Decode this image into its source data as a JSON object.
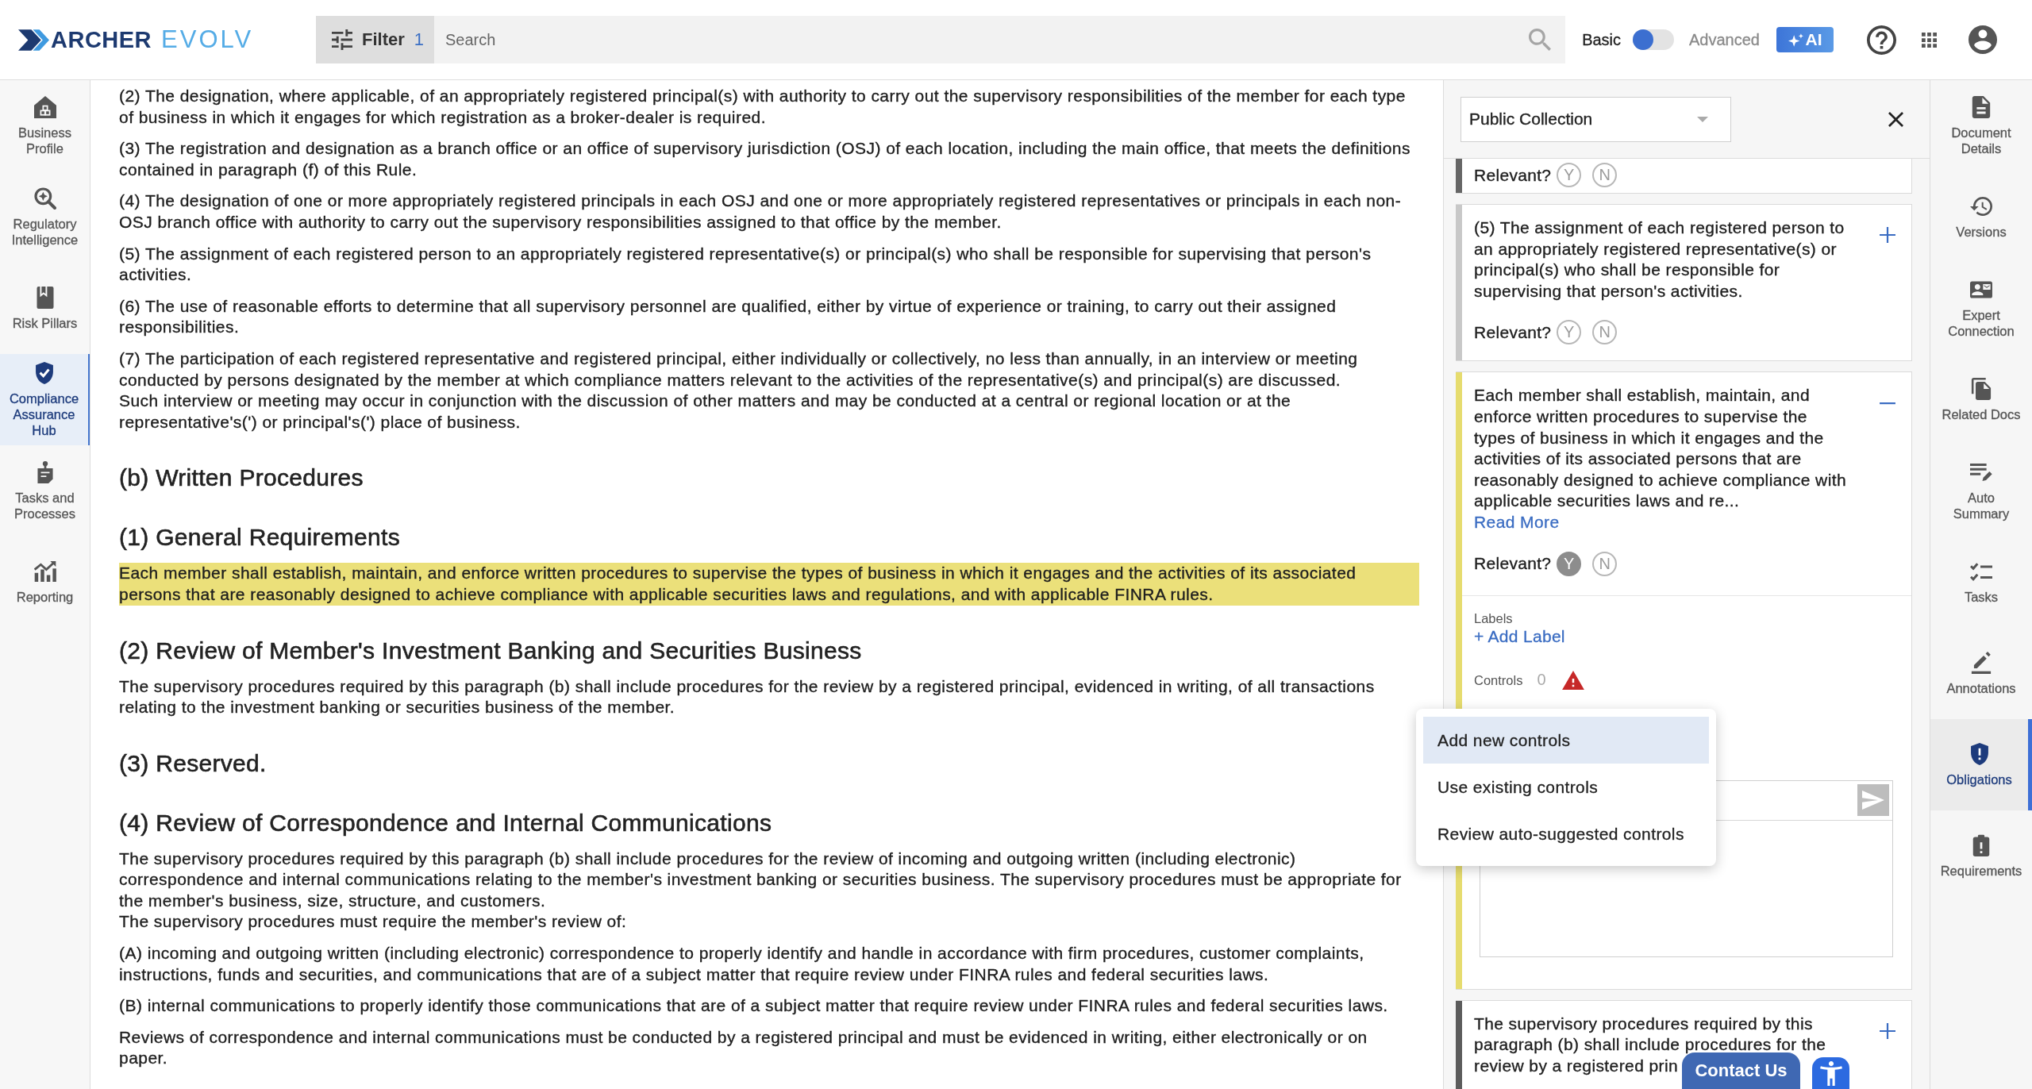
{
  "header": {
    "logo": {
      "brand": "ARCHER",
      "product": "EVOLV"
    },
    "filter": {
      "label": "Filter",
      "count": "1"
    },
    "search": {
      "placeholder": "Search"
    },
    "mode_toggle": {
      "left_label": "Basic",
      "right_label": "Advanced",
      "on": false
    },
    "ai_button": {
      "label": "AI"
    }
  },
  "left_nav": {
    "items": [
      {
        "label": "Business Profile",
        "selected": false
      },
      {
        "label": "Regulatory Intelligence",
        "selected": false
      },
      {
        "label": "Risk Pillars",
        "selected": false
      },
      {
        "label": "Compliance Assurance Hub",
        "selected": true
      },
      {
        "label": "Tasks and Processes",
        "selected": false
      },
      {
        "label": "Reporting",
        "selected": false
      }
    ]
  },
  "document": {
    "blocks": [
      {
        "kind": "paragraph",
        "highlighted": false,
        "lines": [
          "(2) The designation, where applicable, of an appropriately registered principal(s) with authority to carry out the supervisory responsibilities of the member for each type of business in which it engages for which registration as a broker-dealer is required."
        ]
      },
      {
        "kind": "paragraph",
        "highlighted": false,
        "lines": [
          "(3) The registration and designation as a branch office or an office of supervisory jurisdiction (OSJ) of each location, including the main office, that meets the definitions contained in paragraph (f) of this Rule."
        ]
      },
      {
        "kind": "paragraph",
        "highlighted": false,
        "lines": [
          "(4) The designation of one or more appropriately registered principals in each OSJ and one or more appropriately registered representatives or principals in each non-OSJ branch office with authority to carry out the supervisory responsibilities assigned to that office by the member."
        ]
      },
      {
        "kind": "paragraph",
        "highlighted": false,
        "lines": [
          "(5) The assignment of each registered person to an appropriately registered representative(s) or principal(s) who shall be responsible for supervising that person's activities."
        ]
      },
      {
        "kind": "paragraph",
        "highlighted": false,
        "lines": [
          "(6) The use of reasonable efforts to determine that all supervisory personnel are qualified, either by virtue of experience or training, to carry out their assigned responsibilities."
        ]
      },
      {
        "kind": "paragraph",
        "highlighted": false,
        "lines": [
          "(7) The participation of each registered representative and registered principal, either individually or collectively, no less than annually, in an interview or meeting conducted by persons designated by the member at which compliance matters relevant to the activities of the representative(s) and principal(s) are discussed.",
          "Such interview or meeting may occur in conjunction with the discussion of other matters and may be conducted at a central or regional location or at the representative's(') or principal's(') place of business."
        ]
      },
      {
        "kind": "heading",
        "text": "(b) Written Procedures"
      },
      {
        "kind": "heading",
        "text": "(1) General Requirements"
      },
      {
        "kind": "paragraph",
        "highlighted": true,
        "lines": [
          "Each member shall establish, maintain, and enforce written procedures to supervise the types of business in which it engages and the activities of its associated persons that are reasonably designed to achieve compliance with applicable securities laws and regulations, and with applicable FINRA rules."
        ]
      },
      {
        "kind": "heading",
        "text": "(2) Review of Member's Investment Banking and Securities Business"
      },
      {
        "kind": "paragraph",
        "highlighted": false,
        "lines": [
          "The supervisory procedures required by this paragraph (b) shall include procedures for the review by a registered principal, evidenced in writing, of all transactions relating to the investment banking or securities business of the member."
        ]
      },
      {
        "kind": "heading",
        "text": "(3) Reserved."
      },
      {
        "kind": "heading",
        "text": "(4) Review of Correspondence and Internal Communications"
      },
      {
        "kind": "paragraph",
        "highlighted": false,
        "lines": [
          "The supervisory procedures required by this paragraph (b) shall include procedures for the review of incoming and outgoing written (including electronic) correspondence and internal communications relating to the member's investment banking or securities business. The supervisory procedures must be appropriate for the member's business, size, structure, and customers.",
          "The supervisory procedures must require the member's review of:"
        ]
      },
      {
        "kind": "paragraph",
        "highlighted": false,
        "lines": [
          "(A) incoming and outgoing written (including electronic) correspondence to properly identify and handle in accordance with firm procedures, customer complaints, instructions, funds and securities, and communications that are of a subject matter that require review under FINRA rules and federal securities laws."
        ]
      },
      {
        "kind": "paragraph",
        "highlighted": false,
        "lines": [
          "(B) internal communications to properly identify those communications that are of a subject matter that require review under FINRA rules and federal securities laws."
        ]
      },
      {
        "kind": "paragraph",
        "highlighted": false,
        "lines": [
          "Reviews of correspondence and internal communications must be conducted by a registered principal and must be evidenced in writing, either electronically or on paper."
        ]
      }
    ]
  },
  "panel": {
    "collection_select": {
      "value": "Public Collection"
    },
    "cards": [
      {
        "kind": "clipped",
        "color": "#666666",
        "relevant": {
          "label": "Relevant?",
          "options": [
            {
              "label": "Y",
              "selected": false
            },
            {
              "label": "N",
              "selected": false
            }
          ]
        }
      },
      {
        "kind": "full",
        "color": "#c8c8c8",
        "expanded": false,
        "text_parts": [
          "(5) The assignment of each registered person to an appropriately registered representative(s) or principal(s) who shall be responsible for supervising that person's activities."
        ],
        "relevant": {
          "label": "Relevant?",
          "options": [
            {
              "label": "Y",
              "selected": false
            },
            {
              "label": "N",
              "selected": false
            }
          ]
        }
      },
      {
        "kind": "full",
        "color": "#e6dc6e",
        "expanded": true,
        "text_parts": [
          "Each member shall establish, maintain, and enforce written procedures to supervise the types of business in which it engages and the activities of its associated persons that are reasonably designed to achieve compliance with applicable securities laws and re..."
        ],
        "read_more": "Read More",
        "relevant": {
          "label": "Relevant?",
          "options": [
            {
              "label": "Y",
              "selected": true
            },
            {
              "label": "N",
              "selected": false
            }
          ]
        },
        "labels": {
          "title": "Labels",
          "add_link": "+ Add Label"
        },
        "controls": {
          "label": "Controls",
          "count": "0",
          "warning": true
        }
      },
      {
        "kind": "full",
        "color": "#5c5c5c",
        "expanded": false,
        "text_parts": [
          "The supervisory procedures required by this paragraph (b) shall include procedures for the",
          "review by a registered prin"
        ]
      }
    ],
    "controls_menu": {
      "items": [
        {
          "label": "Add new controls",
          "selected": true
        },
        {
          "label": "Use existing controls",
          "selected": false
        },
        {
          "label": "Review auto-suggested controls",
          "selected": false
        }
      ]
    }
  },
  "right_nav": {
    "items": [
      {
        "label": "Document Details",
        "selected": false
      },
      {
        "label": "Versions",
        "selected": false
      },
      {
        "label": "Expert Connection",
        "selected": false
      },
      {
        "label": "Related Docs",
        "selected": false
      },
      {
        "label": "Auto Summary",
        "selected": false
      },
      {
        "label": "Tasks",
        "selected": false
      },
      {
        "label": "Annotations",
        "selected": false
      },
      {
        "label": "Obligations",
        "selected": true
      },
      {
        "label": "Requirements",
        "selected": false
      }
    ]
  },
  "contact_button": {
    "label": "Contact Us"
  }
}
